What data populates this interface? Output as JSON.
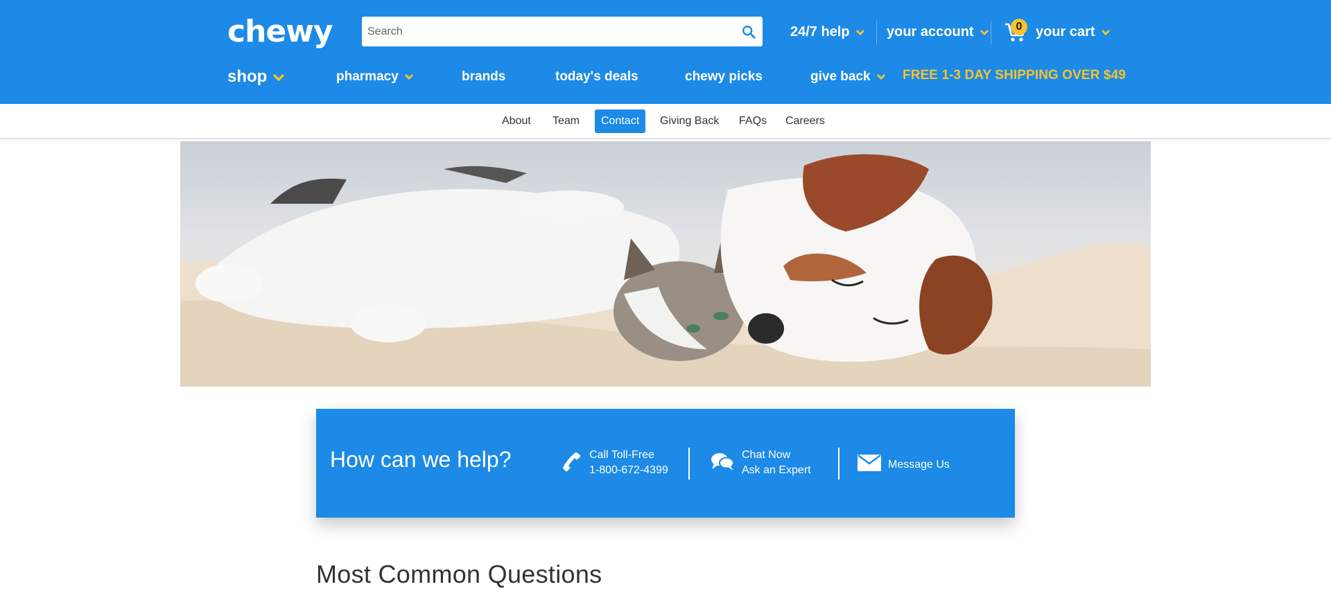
{
  "brand": {
    "logo_text": "chewy",
    "accent": "#1c8ae6",
    "highlight": "#f7c32e"
  },
  "search": {
    "placeholder": "Search"
  },
  "header_links": {
    "help": "24/7 help",
    "account": "your account",
    "cart": "your cart",
    "cart_count": "0"
  },
  "main_nav": {
    "shop": "shop",
    "pharmacy": "pharmacy",
    "brands": "brands",
    "deals": "today's deals",
    "picks": "chewy picks",
    "give_back": "give back",
    "promo": "FREE 1-3 DAY SHIPPING OVER $49"
  },
  "sub_nav": {
    "items": [
      "About",
      "Team",
      "Contact",
      "Giving Back",
      "FAQs",
      "Careers"
    ],
    "active": "Contact"
  },
  "help_box": {
    "title": "How can we help?",
    "call_label": "Call Toll-Free",
    "call_number": "1-800-672-4399",
    "chat_label": "Chat Now",
    "chat_sub": "Ask an Expert",
    "message_label": "Message Us"
  },
  "faq": {
    "heading": "Most Common Questions"
  },
  "icons": {
    "search": "search-icon",
    "cart": "cart-icon",
    "phone": "phone-icon",
    "chat": "chat-icon",
    "mail": "mail-icon",
    "chevron": "chevron-down-icon"
  }
}
